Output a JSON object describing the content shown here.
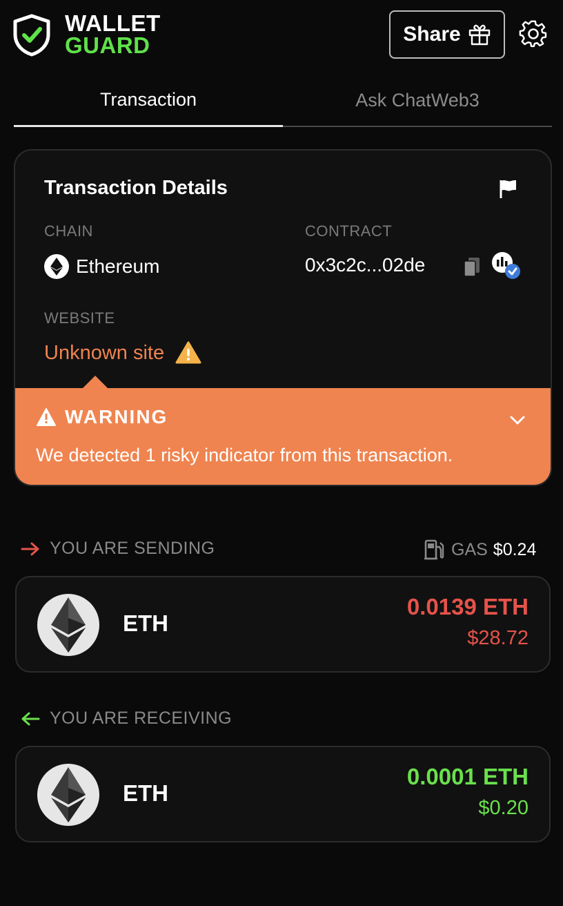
{
  "header": {
    "logo_line1": "WALLET",
    "logo_line2": "GUARD",
    "share_label": "Share"
  },
  "tabs": [
    {
      "label": "Transaction",
      "active": true
    },
    {
      "label": "Ask ChatWeb3",
      "active": false
    }
  ],
  "details": {
    "title": "Transaction Details",
    "chain_label": "CHAIN",
    "chain_value": "Ethereum",
    "contract_label": "CONTRACT",
    "contract_value": "0x3c2c...02de",
    "website_label": "WEBSITE",
    "website_value": "Unknown site"
  },
  "warning": {
    "title": "WARNING",
    "message": "We detected 1 risky indicator from this transaction."
  },
  "sending": {
    "label": "YOU ARE SENDING",
    "gas_label": "GAS",
    "gas_value": "$0.24",
    "asset": "ETH",
    "amount": "0.0139 ETH",
    "usd": "$28.72"
  },
  "receiving": {
    "label": "YOU ARE RECEIVING",
    "asset": "ETH",
    "amount": "0.0001 ETH",
    "usd": "$0.20"
  },
  "colors": {
    "brand_green": "#5fe24a",
    "warning_orange": "#ef8450",
    "send_red": "#e5534b",
    "receive_green": "#6ae04c"
  }
}
